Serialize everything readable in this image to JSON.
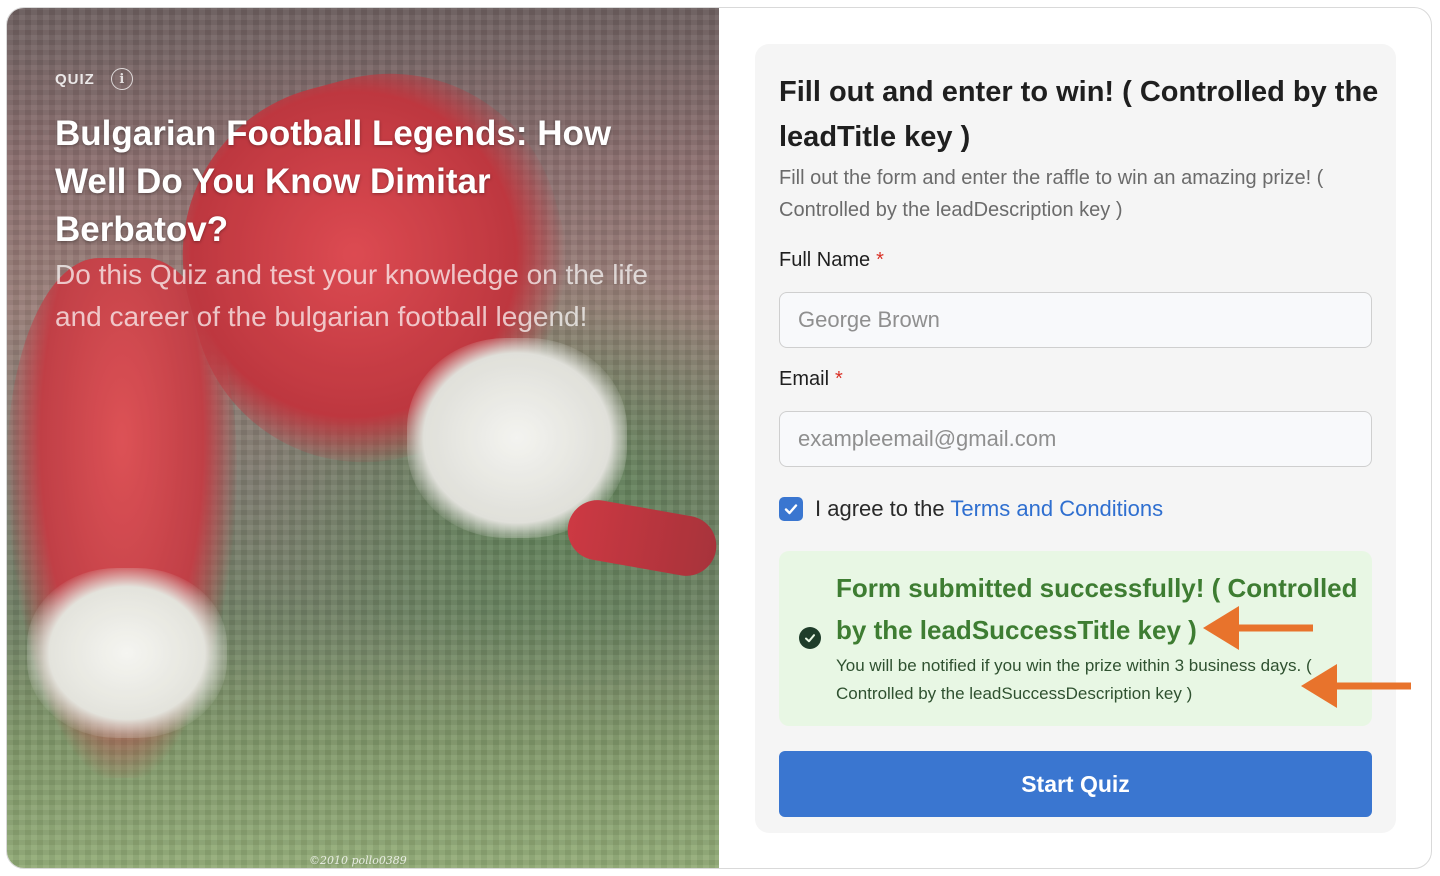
{
  "hero": {
    "label": "QUIZ",
    "info_icon": "info-icon",
    "title": "Bulgarian Football Legends: How Well Do You Know Dimitar Berbatov?",
    "description": "Do this Quiz and test your knowledge on the life and career of the bulgarian football legend!",
    "photo_credit": "©2010 pollo0389"
  },
  "lead": {
    "title": "Fill out and enter to win! ( Controlled by the leadTitle key )",
    "description": "Fill out the form and enter the raffle to win an amazing prize! ( Controlled by the leadDescription key )",
    "full_name": {
      "label": "Full Name",
      "required_mark": "*",
      "placeholder": "George Brown",
      "value": ""
    },
    "email": {
      "label": "Email",
      "required_mark": "*",
      "placeholder": "exampleemail@gmail.com",
      "value": ""
    },
    "agree": {
      "checked": true,
      "text": "I agree to the",
      "link": "Terms and Conditions"
    },
    "success": {
      "icon": "check-circle-icon",
      "title": "Form submitted successfully! ( Controlled by the leadSuccessTitle key )",
      "description": "You will be notified if you win the prize within 3 business days. ( Controlled by the leadSuccessDescription key )"
    },
    "button": "Start Quiz"
  },
  "colors": {
    "accent": "#3a76d0",
    "success_bg": "#e8f7e4",
    "success_title": "#3e7d32",
    "annotation_arrow": "#e8732c",
    "required": "#d93025"
  }
}
